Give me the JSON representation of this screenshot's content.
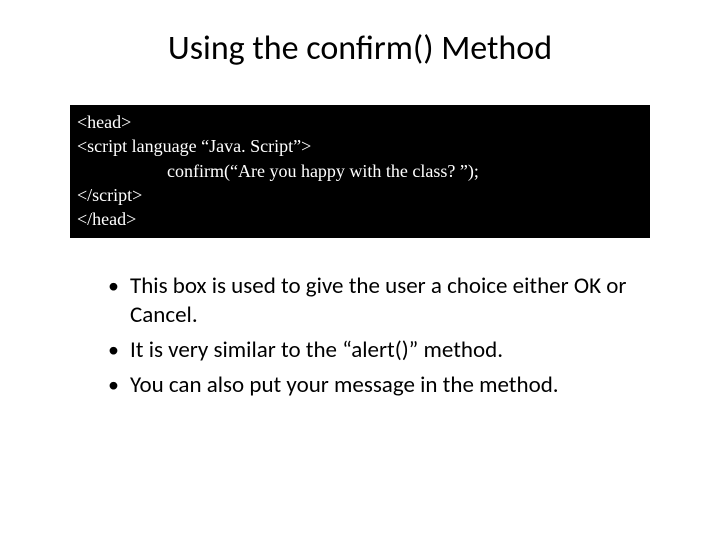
{
  "title": "Using the confirm() Method",
  "code": {
    "line1": "<head>",
    "line2": "<script language “Java. Script”>",
    "line3": "confirm(“Are you happy with the class? ”);",
    "line4": "</script>",
    "line5": "</head>"
  },
  "bullets": [
    "This box is used to give the user a choice either OK or Cancel.",
    "It is very similar to the “alert()” method.",
    "You can also put your message in the method."
  ]
}
